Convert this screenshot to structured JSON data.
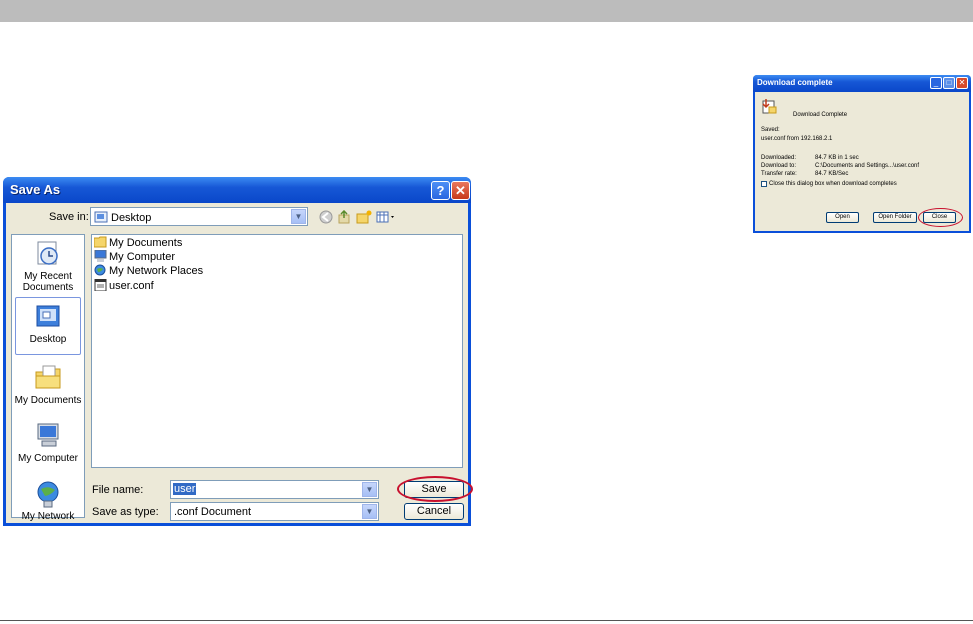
{
  "save_as": {
    "title": "Save As",
    "save_in_label": "Save in:",
    "save_in_value": "Desktop",
    "places": [
      {
        "label": "My Recent Documents"
      },
      {
        "label": "Desktop"
      },
      {
        "label": "My Documents"
      },
      {
        "label": "My Computer"
      },
      {
        "label": "My Network"
      }
    ],
    "files": [
      {
        "name": "My Documents"
      },
      {
        "name": "My Computer"
      },
      {
        "name": "My Network Places"
      },
      {
        "name": "user.conf"
      }
    ],
    "file_name_label": "File name:",
    "file_name_value": "user",
    "save_as_type_label": "Save as type:",
    "save_as_type_value": ".conf Document",
    "save_label": "Save",
    "cancel_label": "Cancel"
  },
  "download": {
    "title": "Download complete",
    "heading": "Download Complete",
    "saved_label": "Saved:",
    "saved_value": "user.conf from 192.168.2.1",
    "downloaded_label": "Downloaded:",
    "downloaded_value": "84.7 KB in 1 sec",
    "download_to_label": "Download to:",
    "download_to_value": "C:\\Documents and Settings...\\user.conf",
    "transfer_rate_label": "Transfer rate:",
    "transfer_rate_value": "84.7 KB/Sec",
    "checkbox_label": "Close this dialog box when download completes",
    "open_label": "Open",
    "open_folder_label": "Open Folder",
    "close_label": "Close"
  },
  "colors": {
    "highlight_ring": "#c8102e",
    "titlebar_blue": "#0a4fd9",
    "dialog_face": "#ece9d8"
  }
}
